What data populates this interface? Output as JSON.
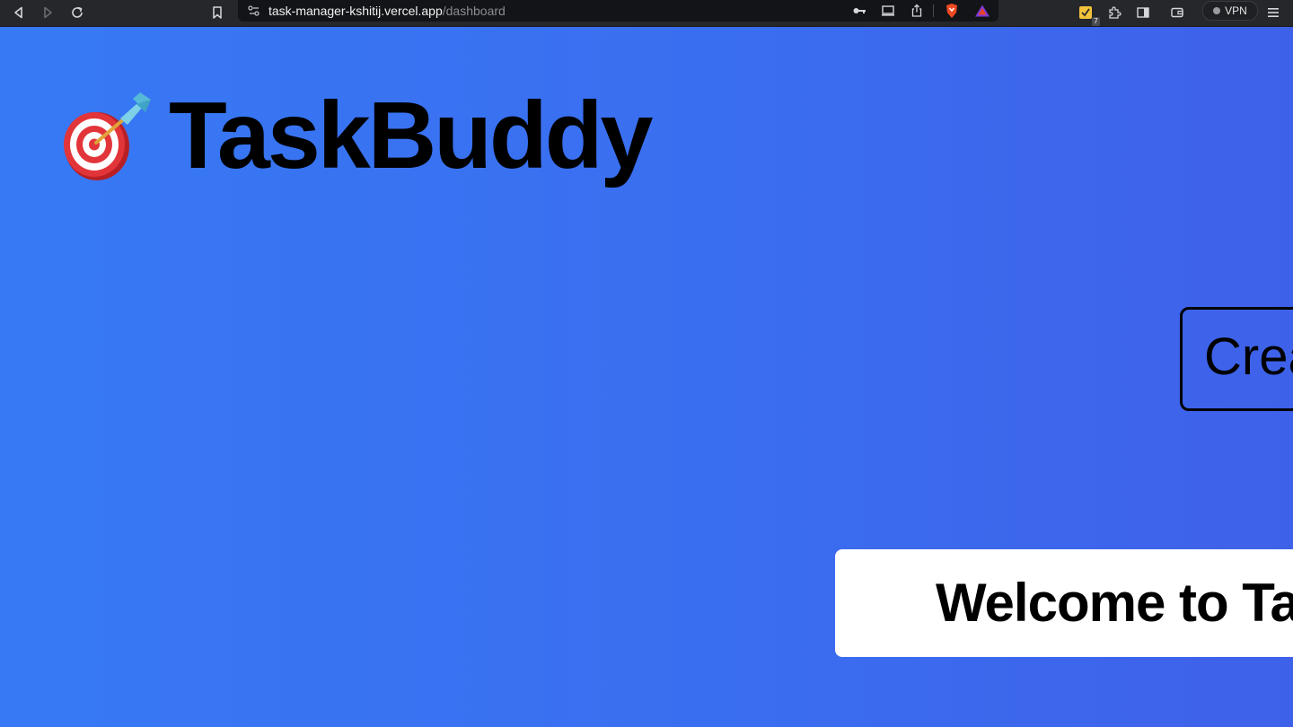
{
  "browser": {
    "url_host": "task-manager-kshitij.vercel.app",
    "url_path": "/dashboard",
    "extension_badge": "7",
    "vpn_label": "VPN",
    "icons": [
      "back-icon",
      "forward-icon",
      "reload-icon",
      "bookmark-icon",
      "site-settings-icon",
      "key-icon",
      "cast-icon",
      "share-icon",
      "brave-shields-icon",
      "brave-rewards-icon",
      "extension-todo-icon",
      "extensions-icon",
      "sidebar-icon",
      "wallet-icon",
      "menu-icon"
    ]
  },
  "app": {
    "brand_icon": "dart-target-icon",
    "brand_name": "TaskBuddy",
    "create_button_label": "Create",
    "welcome_text": "Welcome to TaskBuddy"
  },
  "colors": {
    "page_gradient_start": "#3779f4",
    "page_gradient_end": "#3e61e9",
    "card_background": "#ffffff",
    "text": "#000000",
    "chrome_background": "#26272b"
  }
}
